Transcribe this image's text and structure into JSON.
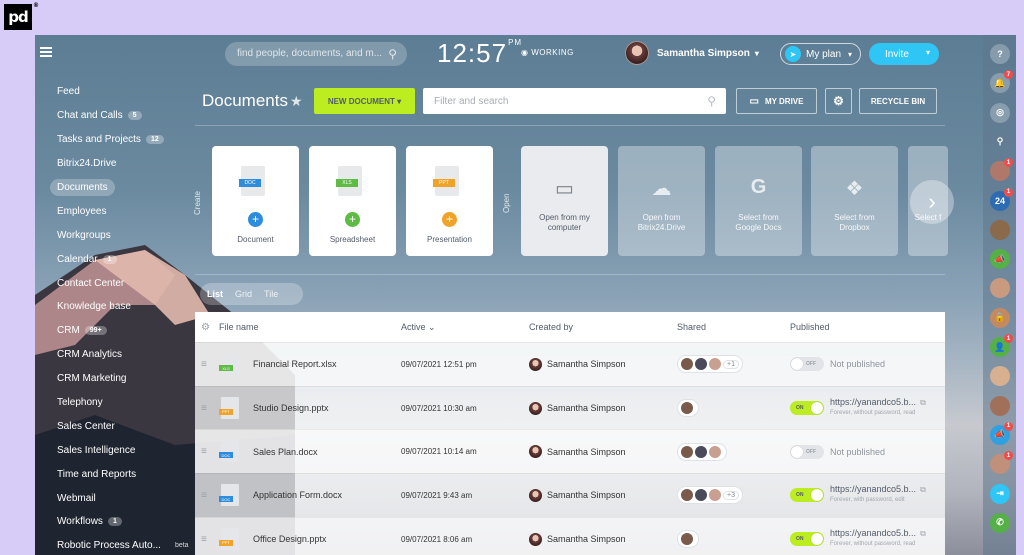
{
  "brand": {
    "logo": "pd",
    "mark": "®"
  },
  "topbar": {
    "search_placeholder": "find people, documents, and m...",
    "time": "12:57",
    "ampm": "PM",
    "status": "WORKING",
    "user_name": "Samantha Simpson",
    "myplan_label": "My plan",
    "invite_label": "Invite"
  },
  "nav": [
    {
      "label": "Feed"
    },
    {
      "label": "Chat and Calls",
      "count": "5"
    },
    {
      "label": "Tasks and Projects",
      "count": "12"
    },
    {
      "label": "Bitrix24.Drive"
    },
    {
      "label": "Documents",
      "active": true
    },
    {
      "label": "Employees"
    },
    {
      "label": "Workgroups"
    },
    {
      "label": "Calendar",
      "count": "1"
    },
    {
      "label": "Contact Center"
    },
    {
      "label": "Knowledge base"
    },
    {
      "label": "CRM",
      "count": "99+"
    },
    {
      "label": "CRM Analytics"
    },
    {
      "label": "CRM Marketing"
    },
    {
      "label": "Telephony"
    },
    {
      "label": "Sales Center"
    },
    {
      "label": "Sales Intelligence"
    },
    {
      "label": "Time and Reports"
    },
    {
      "label": "Webmail"
    },
    {
      "label": "Workflows",
      "count": "1"
    },
    {
      "label": "Robotic Process Auto...",
      "note": "beta"
    }
  ],
  "page": {
    "title": "Documents",
    "new_document": "NEW DOCUMENT",
    "filter_placeholder": "Filter and search",
    "my_drive": "MY DRIVE",
    "recycle_bin": "RECYCLE BIN",
    "create_label": "Create",
    "open_label": "Open"
  },
  "create_cards": [
    {
      "type": "DOC",
      "label": "Document",
      "color": "#2d8cdb"
    },
    {
      "type": "XLS",
      "label": "Spreadsheet",
      "color": "#5ebc45"
    },
    {
      "type": "PPT",
      "label": "Presentation",
      "color": "#f0a329"
    }
  ],
  "open_cards": [
    {
      "line1": "Open from my",
      "line2": "computer",
      "icon": "drive-icon"
    },
    {
      "line1": "Open from",
      "line2": "Bitrix24.Drive",
      "icon": "cloud-upload-icon"
    },
    {
      "line1": "Select from",
      "line2": "Google Docs",
      "icon": "google-icon"
    },
    {
      "line1": "Select from",
      "line2": "Dropbox",
      "icon": "dropbox-icon"
    },
    {
      "line1": "Select f",
      "line2": "",
      "icon": "chevron-right-icon"
    }
  ],
  "view_tabs": [
    "List",
    "Grid",
    "Tile"
  ],
  "table": {
    "headers": {
      "name": "File name",
      "active": "Active",
      "created": "Created by",
      "shared": "Shared",
      "published": "Published"
    },
    "rows": [
      {
        "type": "XLS",
        "color": "#5ebc45",
        "name": "Financial Report.xlsx",
        "date": "09/07/2021 12:51 pm",
        "owner": "Samantha Simpson",
        "shared_count": 3,
        "shared_more": "+1",
        "published": false,
        "pub_text": "Not published"
      },
      {
        "type": "PPT",
        "color": "#f0a329",
        "name": "Studio Design.pptx",
        "date": "09/07/2021 10:30 am",
        "owner": "Samantha Simpson",
        "shared_count": 1,
        "shared_more": "",
        "published": true,
        "pub_text": "https://yanandco5.b...",
        "pub_sub": "Forever, without password, read"
      },
      {
        "type": "DOC",
        "color": "#2d8cdb",
        "name": "Sales Plan.docx",
        "date": "09/07/2021 10:14 am",
        "owner": "Samantha Simpson",
        "shared_count": 3,
        "shared_more": "",
        "published": false,
        "pub_text": "Not published"
      },
      {
        "type": "DOC",
        "color": "#2d8cdb",
        "name": "Application Form.docx",
        "date": "09/07/2021 9:43 am",
        "owner": "Samantha Simpson",
        "shared_count": 3,
        "shared_more": "+3",
        "published": true,
        "pub_text": "https://yanandco5.b...",
        "pub_sub": "Forever, with password, edit"
      },
      {
        "type": "PPT",
        "color": "#f0a329",
        "name": "Office Design.pptx",
        "date": "09/07/2021 8:06 am",
        "owner": "Samantha Simpson",
        "shared_count": 1,
        "shared_more": "",
        "published": true,
        "pub_text": "https://yanandco5.b...",
        "pub_sub": "Forever, without password, read"
      }
    ],
    "toggle_on": "ON",
    "toggle_off": "OFF"
  },
  "right_strip": [
    {
      "icon": "help-icon",
      "glyph": "?",
      "bg": "rgba(255,255,255,.25)"
    },
    {
      "icon": "bell-icon",
      "glyph": "🔔",
      "bg": "rgba(255,255,255,.25)",
      "badge": "7"
    },
    {
      "icon": "chat-icon",
      "glyph": "◎",
      "bg": "rgba(255,255,255,.25)"
    },
    {
      "icon": "search-icon",
      "glyph": "⚲",
      "bg": "transparent"
    },
    {
      "icon": "contact-avatar-icon",
      "glyph": "",
      "bg": "#b0786a",
      "badge": "1"
    },
    {
      "icon": "bitrix24-icon",
      "glyph": "24",
      "bg": "#2d6bb3",
      "badge": "1"
    },
    {
      "icon": "group-avatar-icon",
      "glyph": "",
      "bg": "#8a6a4a"
    },
    {
      "icon": "megaphone-icon",
      "glyph": "📣",
      "bg": "#55b047"
    },
    {
      "icon": "contact-avatar-icon",
      "glyph": "",
      "bg": "#c89a80"
    },
    {
      "icon": "lock-icon",
      "glyph": "🔒",
      "bg": "#c38a62"
    },
    {
      "icon": "user-icon",
      "glyph": "👤",
      "bg": "#55b047",
      "badge": "1"
    },
    {
      "icon": "contact-avatar-icon",
      "glyph": "",
      "bg": "#d8b090"
    },
    {
      "icon": "contact-avatar-icon",
      "glyph": "",
      "bg": "#a0705a"
    },
    {
      "icon": "megaphone-icon",
      "glyph": "📣",
      "bg": "#2fa0e0",
      "badge": "1"
    },
    {
      "icon": "contact-avatar-icon",
      "glyph": "",
      "bg": "#c0907a",
      "badge": "1"
    },
    {
      "icon": "exit-icon",
      "glyph": "⇥",
      "bg": "#2fc6f6"
    },
    {
      "icon": "phone-icon",
      "glyph": "✆",
      "bg": "#55b047"
    }
  ]
}
